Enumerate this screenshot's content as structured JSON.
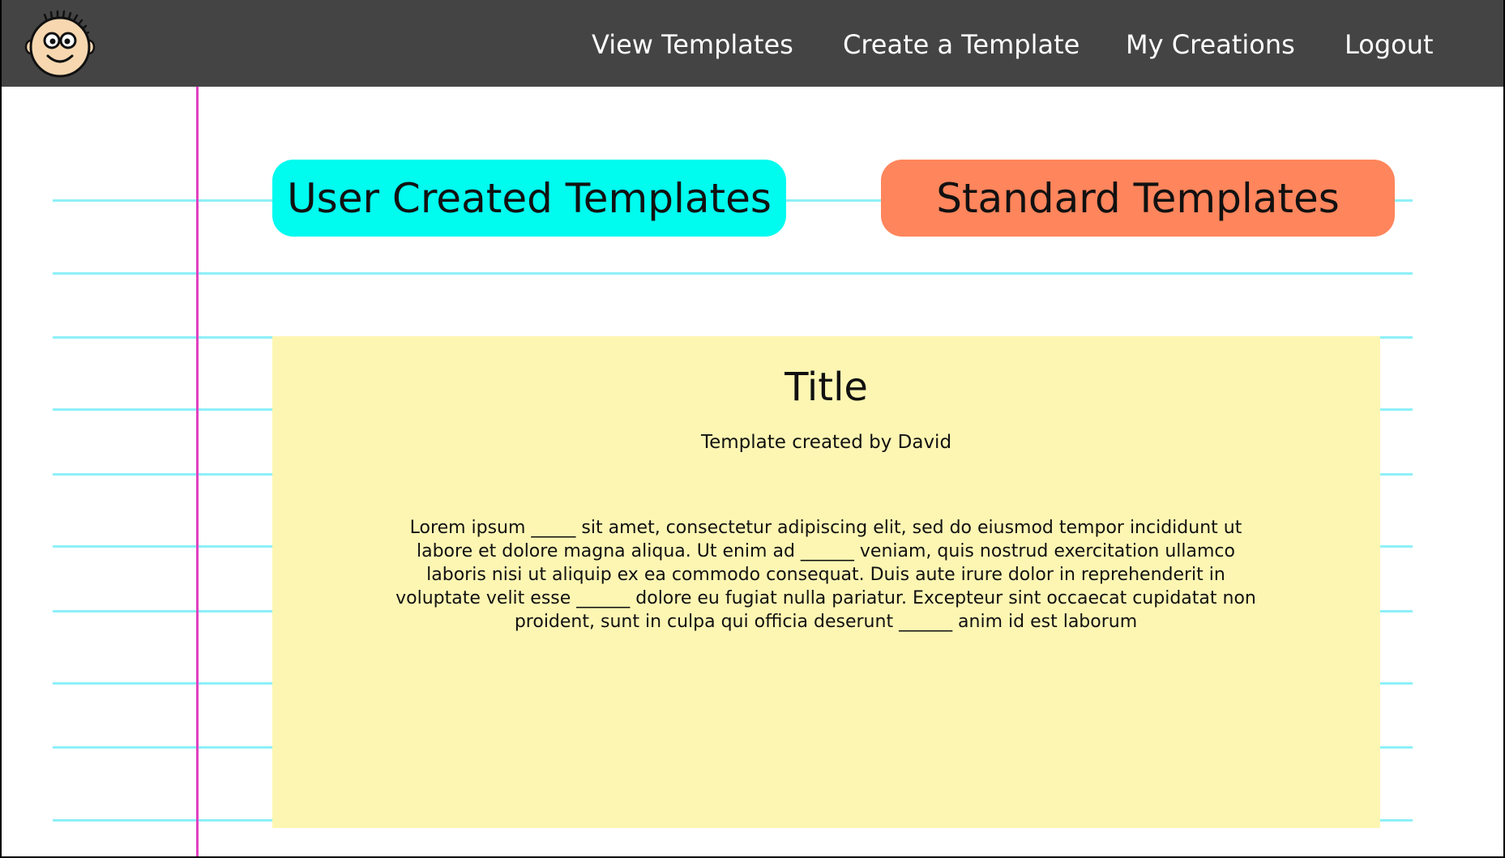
{
  "nav": {
    "logo_icon": "cartoon-face-icon",
    "links": {
      "view_templates": "View Templates",
      "create_template": "Create a Template",
      "my_creations": "My Creations",
      "logout": "Logout"
    }
  },
  "tabs": {
    "user_created": "User Created Templates",
    "standard": "Standard Templates"
  },
  "template": {
    "title": "Title",
    "author": "Template created by David",
    "body": "Lorem ipsum _____ sit amet, consectetur adipiscing elit, sed do eiusmod tempor incididunt ut labore et dolore magna aliqua. Ut enim ad ______ veniam, quis nostrud exercitation ullamco laboris nisi ut aliquip ex ea commodo consequat. Duis aute irure dolor in reprehenderit in voluptate velit esse ______ dolore eu fugiat nulla pariatur. Excepteur sint occaecat cupidatat non proident, sunt in culpa qui officia deserunt ______ anim id est laborum"
  },
  "colors": {
    "navbar": "#444444",
    "user_tab": "#00fbef",
    "standard_tab": "#ff855c",
    "card": "#fdf6b3",
    "ruled_line": "#8ef0f8",
    "margin_line": "#e040c0"
  }
}
